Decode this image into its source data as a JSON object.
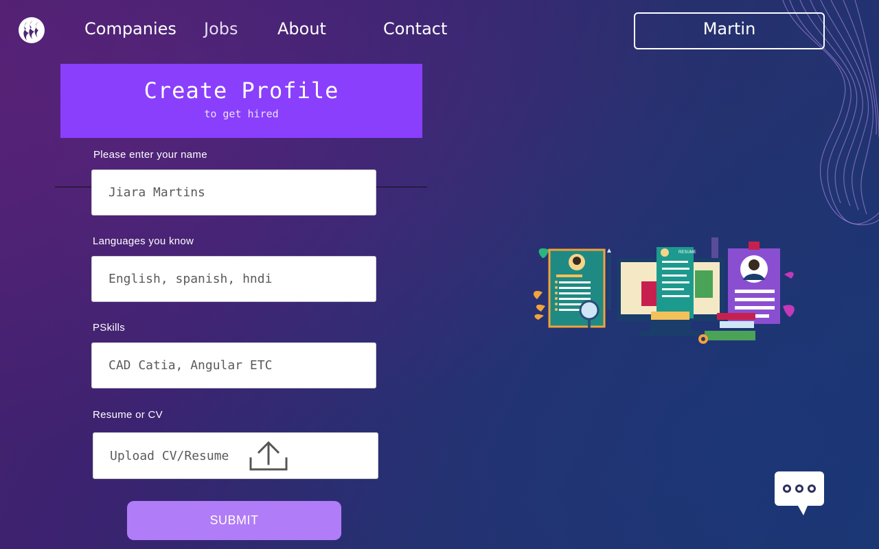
{
  "nav": {
    "links": [
      "Companies",
      "Jobs",
      "About",
      "Contact"
    ],
    "user_name": "Martin"
  },
  "hero": {
    "title": "Create Profile",
    "subtitle": "to get hired"
  },
  "form": {
    "name": {
      "label": "Please enter your name",
      "value": "Jiara Martins"
    },
    "languages": {
      "label": "Languages you know",
      "value": "English, spanish, hndi"
    },
    "skills": {
      "label": "PSkills",
      "value": "CAD Catia, Angular ETC"
    },
    "resume": {
      "label": "Resume or CV",
      "placeholder": "Upload CV/Resume"
    },
    "submit_label": "SUBMIT"
  },
  "illustration": {
    "resume_tag": "RESUME"
  },
  "icons": [
    "brand-logo-icon",
    "upload-icon",
    "chat-bubble-icon"
  ],
  "colors": {
    "accent": "#8a3ffc",
    "submit": "#b07cf7",
    "bg_start": "#4a1f6e",
    "bg_end": "#1d3570"
  }
}
